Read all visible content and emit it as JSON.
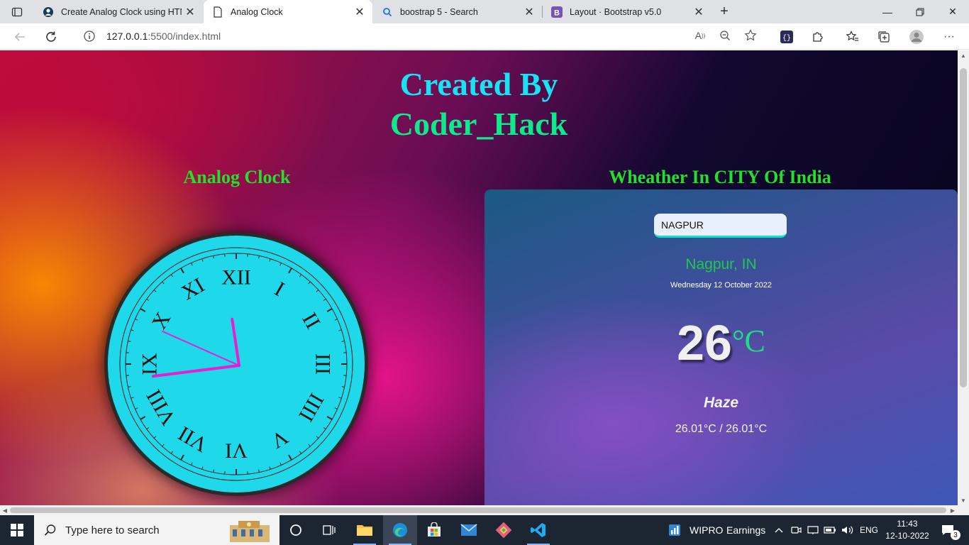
{
  "browser": {
    "tabs": [
      {
        "title": "Create Analog Clock using HTML",
        "icon": "globe-icon"
      },
      {
        "title": "Analog Clock",
        "icon": "page-icon"
      },
      {
        "title": "boostrap 5 - Search",
        "icon": "search-icon"
      },
      {
        "title": "Layout · Bootstrap v5.0",
        "icon": "bootstrap-icon"
      }
    ],
    "active_tab": 1,
    "url_host": "127.0.0.1",
    "url_path": ":5500/index.html"
  },
  "page": {
    "title_line1": "Created By",
    "title_line2": "Coder_Hack",
    "clock_heading": "Analog Clock",
    "weather_heading": "Wheather In CITY Of India"
  },
  "clock": {
    "numerals": [
      "XII",
      "I",
      "II",
      "III",
      "IIII",
      "V",
      "VI",
      "VII",
      "VIII",
      "IX",
      "X",
      "XI"
    ],
    "hour": 11,
    "minute": 43,
    "second": 49,
    "colors": {
      "face": "#1fd9ea",
      "hands": "#e81ed0",
      "bezel": "#2a2a2a"
    }
  },
  "weather": {
    "input_value": "NAGPUR",
    "city": "Nagpur, IN",
    "date": "Wednesday 12 October 2022",
    "temperature": "26",
    "unit": "°C",
    "condition": "Haze",
    "min_max": "26.01°C / 26.01°C"
  },
  "taskbar": {
    "search_placeholder": "Type here to search",
    "stock_label": "WIPRO",
    "stock_status": "Earnings",
    "language": "ENG",
    "time": "11:43",
    "date": "12-10-2022",
    "notification_count": "3"
  }
}
